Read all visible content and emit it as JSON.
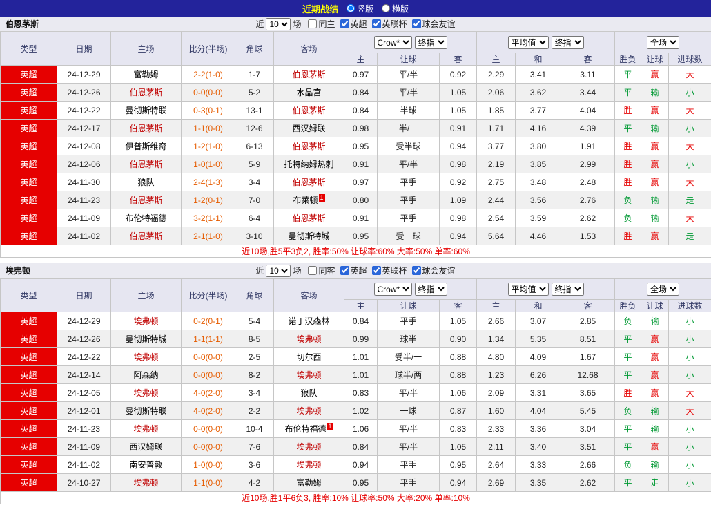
{
  "topbar": {
    "title": "近期战绩",
    "layout_options": [
      {
        "label": "竖版",
        "selected": true
      },
      {
        "label": "横版",
        "selected": false
      }
    ]
  },
  "sections": [
    {
      "team": "伯恩茅斯",
      "filter": {
        "near_label": "近",
        "count": "10",
        "games_label": "场",
        "checkboxes": [
          {
            "label": "同主",
            "checked": false
          },
          {
            "label": "英超",
            "checked": true
          },
          {
            "label": "英联杯",
            "checked": true
          },
          {
            "label": "球会友谊",
            "checked": true
          }
        ]
      },
      "header": {
        "main_cols": [
          "类型",
          "日期",
          "主场",
          "比分(半场)",
          "角球",
          "客场"
        ],
        "odds_selects": [
          "Crow*",
          "终指"
        ],
        "avg_selects": [
          "平均值",
          "终指"
        ],
        "result_selects": [
          "全场"
        ],
        "sub_cols": [
          "主",
          "让球",
          "客",
          "主",
          "和",
          "客",
          "胜负",
          "让球",
          "进球数"
        ]
      },
      "rows": [
        {
          "league": "英超",
          "date": "24-12-29",
          "home": "富勒姆",
          "home_focus": false,
          "score": "2-2(1-0)",
          "corner": "1-7",
          "away": "伯恩茅斯",
          "away_focus": true,
          "odds_home": "0.97",
          "handicap": "平/半",
          "odds_away": "0.92",
          "avg_home": "2.29",
          "avg_draw": "3.41",
          "avg_away": "3.11",
          "result": "平",
          "result_color": "green",
          "handicap_result": "赢",
          "handicap_color": "red",
          "goals": "大",
          "goals_color": "red"
        },
        {
          "league": "英超",
          "date": "24-12-26",
          "home": "伯恩茅斯",
          "home_focus": true,
          "score": "0-0(0-0)",
          "corner": "5-2",
          "away": "水晶宫",
          "away_focus": false,
          "odds_home": "0.84",
          "handicap": "平/半",
          "odds_away": "1.05",
          "avg_home": "2.06",
          "avg_draw": "3.62",
          "avg_away": "3.44",
          "result": "平",
          "result_color": "green",
          "handicap_result": "输",
          "handicap_color": "green",
          "goals": "小",
          "goals_color": "green"
        },
        {
          "league": "英超",
          "date": "24-12-22",
          "home": "曼彻斯特联",
          "home_focus": false,
          "score": "0-3(0-1)",
          "corner": "13-1",
          "away": "伯恩茅斯",
          "away_focus": true,
          "odds_home": "0.84",
          "handicap": "半球",
          "odds_away": "1.05",
          "avg_home": "1.85",
          "avg_draw": "3.77",
          "avg_away": "4.04",
          "result": "胜",
          "result_color": "red",
          "handicap_result": "赢",
          "handicap_color": "red",
          "goals": "大",
          "goals_color": "red"
        },
        {
          "league": "英超",
          "date": "24-12-17",
          "home": "伯恩茅斯",
          "home_focus": true,
          "score": "1-1(0-0)",
          "corner": "12-6",
          "away": "西汉姆联",
          "away_focus": false,
          "odds_home": "0.98",
          "handicap": "半/一",
          "odds_away": "0.91",
          "avg_home": "1.71",
          "avg_draw": "4.16",
          "avg_away": "4.39",
          "result": "平",
          "result_color": "green",
          "handicap_result": "输",
          "handicap_color": "green",
          "goals": "小",
          "goals_color": "green"
        },
        {
          "league": "英超",
          "date": "24-12-08",
          "home": "伊普斯维奇",
          "home_focus": false,
          "score": "1-2(1-0)",
          "corner": "6-13",
          "away": "伯恩茅斯",
          "away_focus": true,
          "odds_home": "0.95",
          "handicap": "受半球",
          "odds_away": "0.94",
          "avg_home": "3.77",
          "avg_draw": "3.80",
          "avg_away": "1.91",
          "result": "胜",
          "result_color": "red",
          "handicap_result": "赢",
          "handicap_color": "red",
          "goals": "大",
          "goals_color": "red"
        },
        {
          "league": "英超",
          "date": "24-12-06",
          "home": "伯恩茅斯",
          "home_focus": true,
          "score": "1-0(1-0)",
          "corner": "5-9",
          "away": "托特纳姆热刺",
          "away_focus": false,
          "odds_home": "0.91",
          "handicap": "平/半",
          "odds_away": "0.98",
          "avg_home": "2.19",
          "avg_draw": "3.85",
          "avg_away": "2.99",
          "result": "胜",
          "result_color": "red",
          "handicap_result": "赢",
          "handicap_color": "red",
          "goals": "小",
          "goals_color": "green"
        },
        {
          "league": "英超",
          "date": "24-11-30",
          "home": "狼队",
          "home_focus": false,
          "score": "2-4(1-3)",
          "corner": "3-4",
          "away": "伯恩茅斯",
          "away_focus": true,
          "odds_home": "0.97",
          "handicap": "平手",
          "odds_away": "0.92",
          "avg_home": "2.75",
          "avg_draw": "3.48",
          "avg_away": "2.48",
          "result": "胜",
          "result_color": "red",
          "handicap_result": "赢",
          "handicap_color": "red",
          "goals": "大",
          "goals_color": "red"
        },
        {
          "league": "英超",
          "date": "24-11-23",
          "home": "伯恩茅斯",
          "home_focus": true,
          "score": "1-2(0-1)",
          "corner": "7-0",
          "away": "布莱顿",
          "away_focus": false,
          "away_badge": "1",
          "odds_home": "0.80",
          "handicap": "平手",
          "odds_away": "1.09",
          "avg_home": "2.44",
          "avg_draw": "3.56",
          "avg_away": "2.76",
          "result": "负",
          "result_color": "green",
          "handicap_result": "输",
          "handicap_color": "green",
          "goals": "走",
          "goals_color": "green"
        },
        {
          "league": "英超",
          "date": "24-11-09",
          "home": "布伦特福德",
          "home_focus": false,
          "score": "3-2(1-1)",
          "corner": "6-4",
          "away": "伯恩茅斯",
          "away_focus": true,
          "odds_home": "0.91",
          "handicap": "平手",
          "odds_away": "0.98",
          "avg_home": "2.54",
          "avg_draw": "3.59",
          "avg_away": "2.62",
          "result": "负",
          "result_color": "green",
          "handicap_result": "输",
          "handicap_color": "green",
          "goals": "大",
          "goals_color": "red"
        },
        {
          "league": "英超",
          "date": "24-11-02",
          "home": "伯恩茅斯",
          "home_focus": true,
          "score": "2-1(1-0)",
          "corner": "3-10",
          "away": "曼彻斯特城",
          "away_focus": false,
          "odds_home": "0.95",
          "handicap": "受一球",
          "odds_away": "0.94",
          "avg_home": "5.64",
          "avg_draw": "4.46",
          "avg_away": "1.53",
          "result": "胜",
          "result_color": "red",
          "handicap_result": "赢",
          "handicap_color": "red",
          "goals": "走",
          "goals_color": "green"
        }
      ],
      "summary": "近10场,胜5平3负2, 胜率:50% 让球率:60% 大率:50% 单率:60%"
    },
    {
      "team": "埃弗顿",
      "filter": {
        "near_label": "近",
        "count": "10",
        "games_label": "场",
        "checkboxes": [
          {
            "label": "同客",
            "checked": false
          },
          {
            "label": "英超",
            "checked": true
          },
          {
            "label": "英联杯",
            "checked": true
          },
          {
            "label": "球会友谊",
            "checked": true
          }
        ]
      },
      "header": {
        "main_cols": [
          "类型",
          "日期",
          "主场",
          "比分(半场)",
          "角球",
          "客场"
        ],
        "odds_selects": [
          "Crow*",
          "终指"
        ],
        "avg_selects": [
          "平均值",
          "终指"
        ],
        "result_selects": [
          "全场"
        ],
        "sub_cols": [
          "主",
          "让球",
          "客",
          "主",
          "和",
          "客",
          "胜负",
          "让球",
          "进球数"
        ]
      },
      "rows": [
        {
          "league": "英超",
          "date": "24-12-29",
          "home": "埃弗顿",
          "home_focus": true,
          "score": "0-2(0-1)",
          "corner": "5-4",
          "away": "诺丁汉森林",
          "away_focus": false,
          "odds_home": "0.84",
          "handicap": "平手",
          "odds_away": "1.05",
          "avg_home": "2.66",
          "avg_draw": "3.07",
          "avg_away": "2.85",
          "result": "负",
          "result_color": "green",
          "handicap_result": "输",
          "handicap_color": "green",
          "goals": "小",
          "goals_color": "green"
        },
        {
          "league": "英超",
          "date": "24-12-26",
          "home": "曼彻斯特城",
          "home_focus": false,
          "score": "1-1(1-1)",
          "corner": "8-5",
          "away": "埃弗顿",
          "away_focus": true,
          "odds_home": "0.99",
          "handicap": "球半",
          "odds_away": "0.90",
          "avg_home": "1.34",
          "avg_draw": "5.35",
          "avg_away": "8.51",
          "result": "平",
          "result_color": "green",
          "handicap_result": "赢",
          "handicap_color": "red",
          "goals": "小",
          "goals_color": "green"
        },
        {
          "league": "英超",
          "date": "24-12-22",
          "home": "埃弗顿",
          "home_focus": true,
          "score": "0-0(0-0)",
          "corner": "2-5",
          "away": "切尔西",
          "away_focus": false,
          "odds_home": "1.01",
          "handicap": "受半/一",
          "odds_away": "0.88",
          "avg_home": "4.80",
          "avg_draw": "4.09",
          "avg_away": "1.67",
          "result": "平",
          "result_color": "green",
          "handicap_result": "赢",
          "handicap_color": "red",
          "goals": "小",
          "goals_color": "green"
        },
        {
          "league": "英超",
          "date": "24-12-14",
          "home": "阿森纳",
          "home_focus": false,
          "score": "0-0(0-0)",
          "corner": "8-2",
          "away": "埃弗顿",
          "away_focus": true,
          "odds_home": "1.01",
          "handicap": "球半/两",
          "odds_away": "0.88",
          "avg_home": "1.23",
          "avg_draw": "6.26",
          "avg_away": "12.68",
          "result": "平",
          "result_color": "green",
          "handicap_result": "赢",
          "handicap_color": "red",
          "goals": "小",
          "goals_color": "green"
        },
        {
          "league": "英超",
          "date": "24-12-05",
          "home": "埃弗顿",
          "home_focus": true,
          "score": "4-0(2-0)",
          "corner": "3-4",
          "away": "狼队",
          "away_focus": false,
          "odds_home": "0.83",
          "handicap": "平/半",
          "odds_away": "1.06",
          "avg_home": "2.09",
          "avg_draw": "3.31",
          "avg_away": "3.65",
          "result": "胜",
          "result_color": "red",
          "handicap_result": "赢",
          "handicap_color": "red",
          "goals": "大",
          "goals_color": "red"
        },
        {
          "league": "英超",
          "date": "24-12-01",
          "home": "曼彻斯特联",
          "home_focus": false,
          "score": "4-0(2-0)",
          "corner": "2-2",
          "away": "埃弗顿",
          "away_focus": true,
          "odds_home": "1.02",
          "handicap": "一球",
          "odds_away": "0.87",
          "avg_home": "1.60",
          "avg_draw": "4.04",
          "avg_away": "5.45",
          "result": "负",
          "result_color": "green",
          "handicap_result": "输",
          "handicap_color": "green",
          "goals": "大",
          "goals_color": "red"
        },
        {
          "league": "英超",
          "date": "24-11-23",
          "home": "埃弗顿",
          "home_focus": true,
          "score": "0-0(0-0)",
          "corner": "10-4",
          "away": "布伦特福德",
          "away_focus": false,
          "away_badge": "1",
          "odds_home": "1.06",
          "handicap": "平/半",
          "odds_away": "0.83",
          "avg_home": "2.33",
          "avg_draw": "3.36",
          "avg_away": "3.04",
          "result": "平",
          "result_color": "green",
          "handicap_result": "输",
          "handicap_color": "green",
          "goals": "小",
          "goals_color": "green"
        },
        {
          "league": "英超",
          "date": "24-11-09",
          "home": "西汉姆联",
          "home_focus": false,
          "score": "0-0(0-0)",
          "corner": "7-6",
          "away": "埃弗顿",
          "away_focus": true,
          "odds_home": "0.84",
          "handicap": "平/半",
          "odds_away": "1.05",
          "avg_home": "2.11",
          "avg_draw": "3.40",
          "avg_away": "3.51",
          "result": "平",
          "result_color": "green",
          "handicap_result": "赢",
          "handicap_color": "red",
          "goals": "小",
          "goals_color": "green"
        },
        {
          "league": "英超",
          "date": "24-11-02",
          "home": "南安普敦",
          "home_focus": false,
          "score": "1-0(0-0)",
          "corner": "3-6",
          "away": "埃弗顿",
          "away_focus": true,
          "odds_home": "0.94",
          "handicap": "平手",
          "odds_away": "0.95",
          "avg_home": "2.64",
          "avg_draw": "3.33",
          "avg_away": "2.66",
          "result": "负",
          "result_color": "green",
          "handicap_result": "输",
          "handicap_color": "green",
          "goals": "小",
          "goals_color": "green"
        },
        {
          "league": "英超",
          "date": "24-10-27",
          "home": "埃弗顿",
          "home_focus": true,
          "score": "1-1(0-0)",
          "corner": "4-2",
          "away": "富勒姆",
          "away_focus": false,
          "odds_home": "0.95",
          "handicap": "平手",
          "odds_away": "0.94",
          "avg_home": "2.69",
          "avg_draw": "3.35",
          "avg_away": "2.62",
          "result": "平",
          "result_color": "green",
          "handicap_result": "走",
          "handicap_color": "green",
          "goals": "小",
          "goals_color": "green"
        }
      ],
      "summary": "近10场,胜1平6负3, 胜率:10% 让球率:50% 大率:20% 单率:10%"
    }
  ]
}
